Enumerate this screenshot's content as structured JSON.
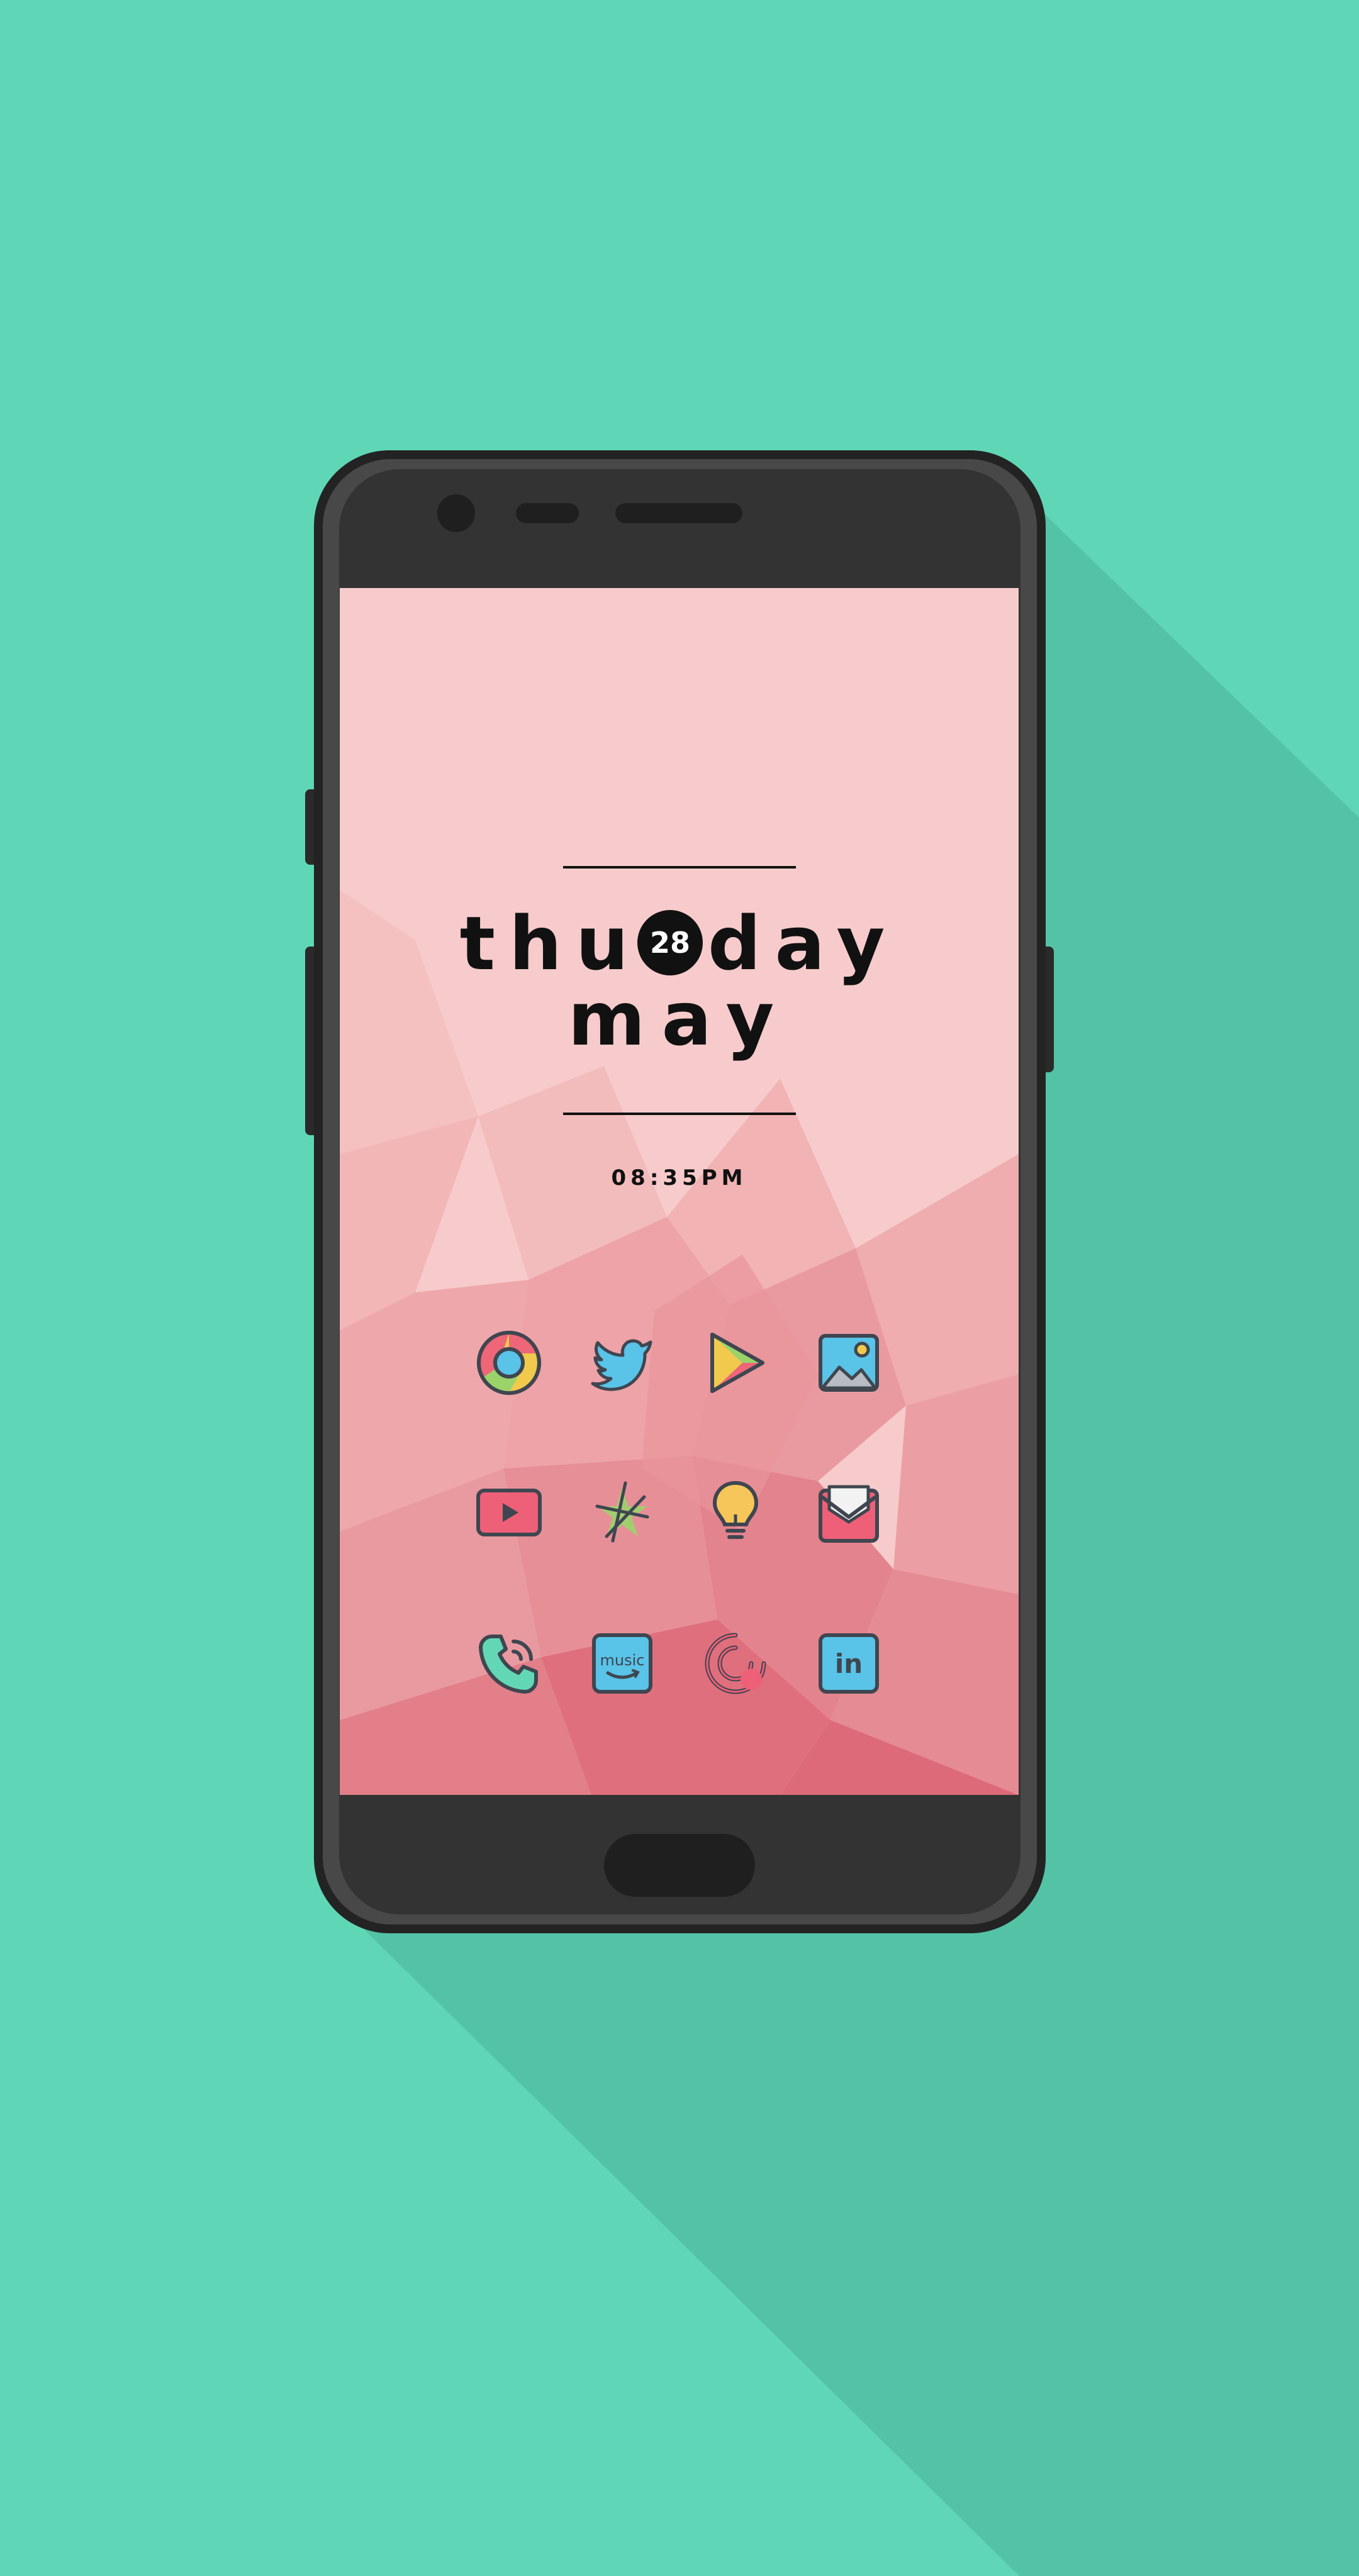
{
  "background": {
    "color": "#5fd7b6",
    "shadow_color": "#54c2a5"
  },
  "phone": {
    "body_color": "#232323",
    "bezel_color": "#333333"
  },
  "screen": {
    "wallpaper_colors": [
      "#f7cbcb",
      "#f2aeb0",
      "#e88790",
      "#df6b7b"
    ],
    "clock_widget": {
      "day_prefix": "thu",
      "date_number": "28",
      "day_suffix": "day",
      "month": "may",
      "time": "08:35PM"
    },
    "app_icons": [
      {
        "icon": "chrome-icon"
      },
      {
        "icon": "twitter-icon"
      },
      {
        "icon": "play-store-icon"
      },
      {
        "icon": "gallery-icon"
      },
      {
        "icon": "youtube-icon"
      },
      {
        "icon": "star-app-icon"
      },
      {
        "icon": "lightbulb-icon"
      },
      {
        "icon": "email-icon"
      },
      {
        "icon": "phone-icon"
      },
      {
        "icon": "amazon-music-icon",
        "label": "music"
      },
      {
        "icon": "pocket-casts-icon"
      },
      {
        "icon": "linkedin-icon",
        "label": "in"
      }
    ]
  }
}
